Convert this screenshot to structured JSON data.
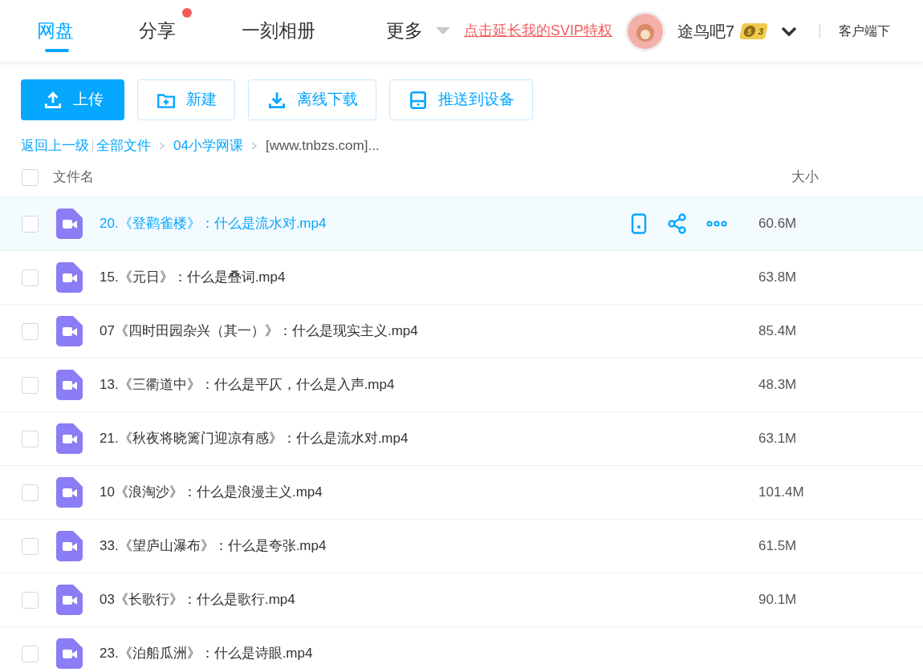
{
  "nav": {
    "tabs": [
      {
        "label": "网盘",
        "selected": true,
        "dot": false
      },
      {
        "label": "分享",
        "selected": false,
        "dot": true
      },
      {
        "label": "一刻相册",
        "selected": false,
        "dot": false
      },
      {
        "label": "更多",
        "selected": false,
        "dot": false,
        "dropdown": true
      }
    ],
    "promo_link": "点击延长我的SVIP特权",
    "username": "途鸟吧7",
    "coin_symbol": "$",
    "level": "3",
    "client_download": "客户端下"
  },
  "toolbar": [
    {
      "label": "上传",
      "kind": "upload",
      "primary": true
    },
    {
      "label": "新建",
      "kind": "new-folder",
      "primary": false
    },
    {
      "label": "离线下载",
      "kind": "download",
      "primary": false
    },
    {
      "label": "推送到设备",
      "kind": "push",
      "primary": false
    }
  ],
  "breadcrumb": {
    "back": "返回上一级",
    "items": [
      "全部文件",
      "04小学网课"
    ],
    "current": "[www.tnbzs.com]..."
  },
  "table": {
    "columns": [
      "文件名",
      "大小"
    ],
    "select_all_checked": false,
    "rows": [
      {
        "name": "20.《登鹳雀楼》：什么是流水对.mp4",
        "size": "60.6M",
        "selected": true,
        "checked": false
      },
      {
        "name": "15.《元日》：什么是叠词.mp4",
        "size": "63.8M",
        "selected": false,
        "checked": false
      },
      {
        "name": "07《四时田园杂兴（其一）》：什么是现实主义.mp4",
        "size": "85.4M",
        "selected": false,
        "checked": false
      },
      {
        "name": "13.《三衢道中》：什么是平仄，什么是入声.mp4",
        "size": "48.3M",
        "selected": false,
        "checked": false
      },
      {
        "name": "21.《秋夜将晓篱门迎凉有感》：什么是流水对.mp4",
        "size": "63.1M",
        "selected": false,
        "checked": false
      },
      {
        "name": "10《浪淘沙》：什么是浪漫主义.mp4",
        "size": "101.4M",
        "selected": false,
        "checked": false
      },
      {
        "name": "33.《望庐山瀑布》：什么是夸张.mp4",
        "size": "61.5M",
        "selected": false,
        "checked": false
      },
      {
        "name": "03《长歌行》：什么是歌行.mp4",
        "size": "90.1M",
        "selected": false,
        "checked": false
      },
      {
        "name": "23.《泊船瓜洲》：什么是诗眼.mp4",
        "selected": false,
        "checked": false
      }
    ]
  }
}
